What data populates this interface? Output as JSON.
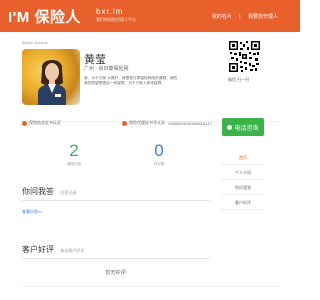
{
  "header": {
    "logo_text": "I'M 保险人",
    "domain": "bxr.im",
    "slogan": "我们的保险代理人平台",
    "links": [
      "我的名片",
      "|",
      "我要找代理人"
    ]
  },
  "profile": {
    "header_text": "Beichi Jessica",
    "name": "黄莹",
    "location": "广州 · 肖日泰保险网",
    "description": "我，大千万家 大赛好，我是泰日泰保险网络的课程，我的，我的愿望是做实一份保障，为千万家人带来保障...",
    "qr_caption": "微信 扫一扫",
    "verify_id": "保险执业证书认证",
    "verify_cert_label": "保险代理证书号认证: ",
    "verify_cert_number": "20000000100000001117"
  },
  "actions": {
    "call_label": "电话咨询"
  },
  "stats": [
    {
      "value": "2",
      "label": "保险问答"
    },
    {
      "value": "0",
      "label": "好评数"
    }
  ],
  "side_menu": [
    "首页",
    "个人介绍",
    "你问我答",
    "客户好评"
  ],
  "sections": {
    "qa": {
      "title": "你问我答",
      "subtitle": "问答记录",
      "link": "查看问答>>"
    },
    "reviews": {
      "title": "客户好评",
      "subtitle": "来自客户好评",
      "empty": "暂无好评!"
    }
  },
  "colors": {
    "brand": "#e8612c",
    "green": "#3bb24a",
    "blue": "#3a7fd5"
  }
}
